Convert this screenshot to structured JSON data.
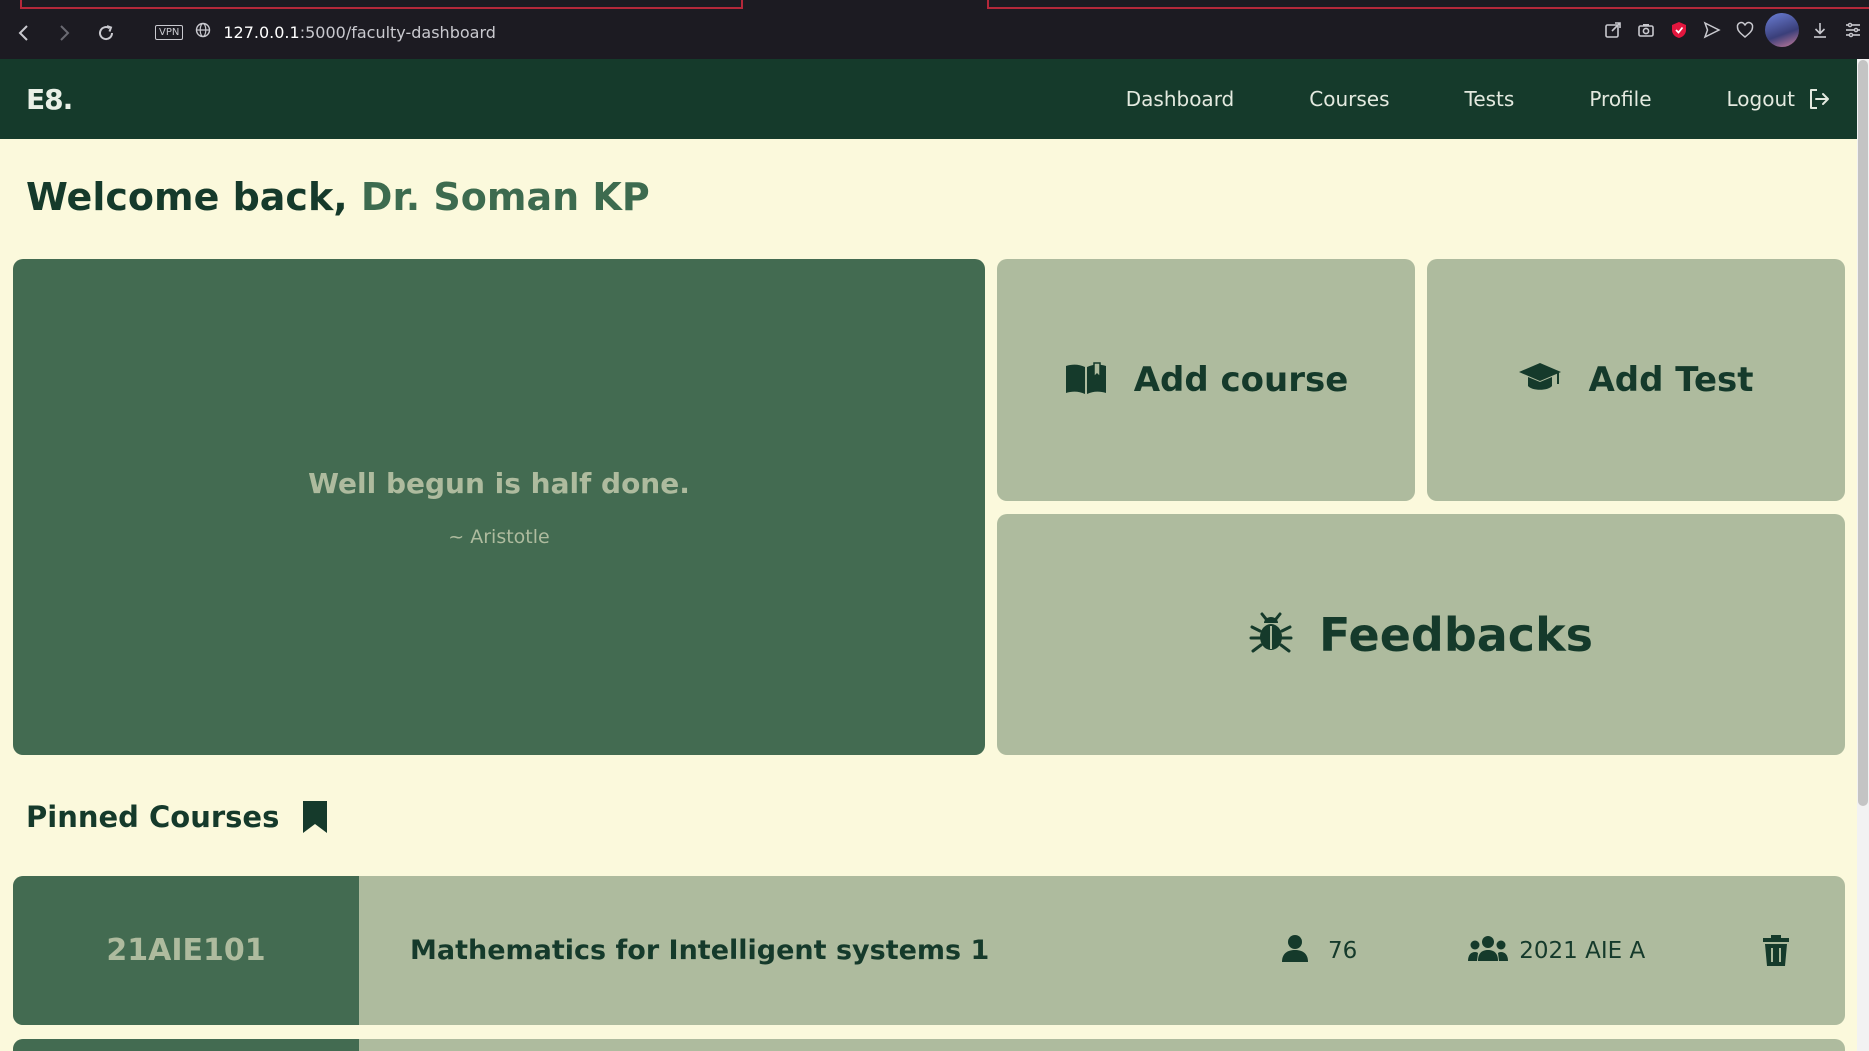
{
  "browser": {
    "url_host": "127.0.0.1",
    "url_path": ":5000/faculty-dashboard",
    "vpn_label": "VPN"
  },
  "nav": {
    "brand": "E8.",
    "links": [
      "Dashboard",
      "Courses",
      "Tests",
      "Profile"
    ],
    "logout": "Logout"
  },
  "welcome": {
    "prefix": "Welcome back,",
    "name": "Dr. Soman KP"
  },
  "quote": {
    "text": "Well begun is half done.",
    "author": "~ Aristotle"
  },
  "actions": {
    "add_course": "Add course",
    "add_test": "Add Test",
    "feedbacks": "Feedbacks"
  },
  "pinned": {
    "title": "Pinned Courses",
    "courses": [
      {
        "code": "21AIE101",
        "name": "Mathematics for Intelligent systems 1",
        "students": "76",
        "batch": "2021 AIE A"
      }
    ]
  },
  "colors": {
    "dark_green": "#153a2b",
    "mid_green": "#436b51",
    "sage": "#aebb9e",
    "cream": "#fbf9dc"
  },
  "icons": {
    "add_course": "book-open-icon",
    "add_test": "graduation-cap-icon",
    "feedbacks": "bug-icon",
    "pinned": "bookmark-icon",
    "students": "user-icon",
    "batch": "users-icon",
    "delete": "trash-icon",
    "logout": "logout-icon"
  }
}
